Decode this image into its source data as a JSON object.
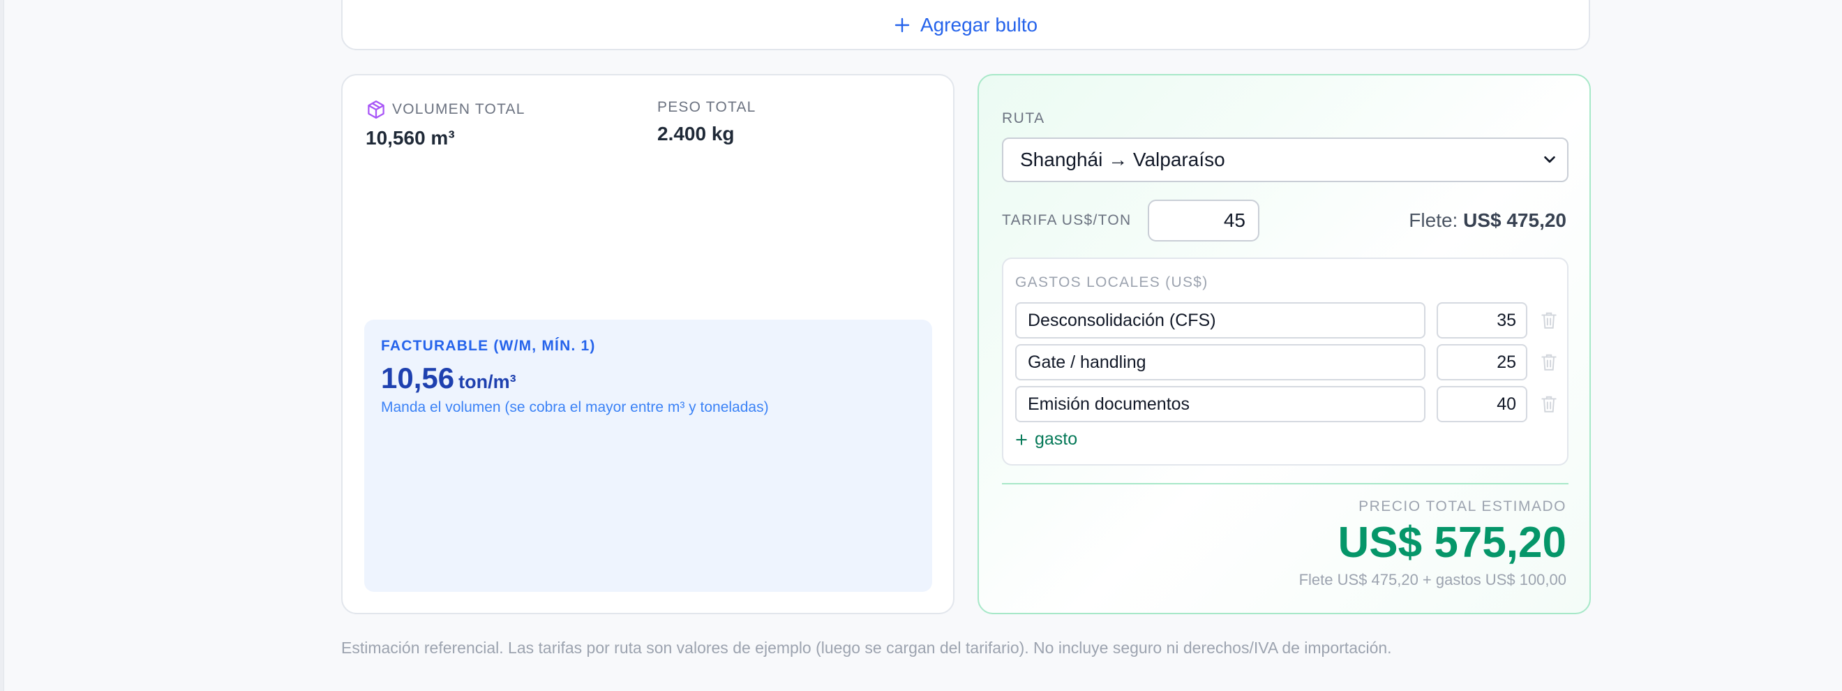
{
  "packages": {
    "add_label": "Agregar bulto"
  },
  "summary": {
    "volume_label": "VOLUMEN TOTAL",
    "volume_value": "10,560 m³",
    "weight_label": "PESO TOTAL",
    "weight_value": "2.400 kg",
    "billable_label": "FACTURABLE (W/M, MÍN. 1)",
    "billable_value": "10,56",
    "billable_unit": "ton/m³",
    "billable_note": "Manda el volumen (se cobra el mayor entre m³ y toneladas)"
  },
  "route": {
    "label": "RUTA",
    "selected": "Shanghái → Valparaíso",
    "rate_label": "TARIFA US$/TON",
    "rate_value": "45",
    "freight_label": "Flete:",
    "freight_value": "US$ 475,20"
  },
  "local_fees": {
    "title": "GASTOS LOCALES (US$)",
    "items": [
      {
        "name": "Desconsolidación (CFS)",
        "amount": "35"
      },
      {
        "name": "Gate / handling",
        "amount": "25"
      },
      {
        "name": "Emisión documentos",
        "amount": "40"
      }
    ],
    "add_label": "gasto"
  },
  "total": {
    "label": "PRECIO TOTAL ESTIMADO",
    "value": "US$ 575,20",
    "breakdown": "Flete US$ 475,20 + gastos US$ 100,00"
  },
  "disclaimer": "Estimación referencial. Las tarifas por ruta son valores de ejemplo (luego se cargan del tarifario). No incluye seguro ni derechos/IVA de importación.",
  "colors": {
    "accent_blue": "#2563eb",
    "accent_green": "#059669",
    "cube_purple": "#a855f7"
  }
}
